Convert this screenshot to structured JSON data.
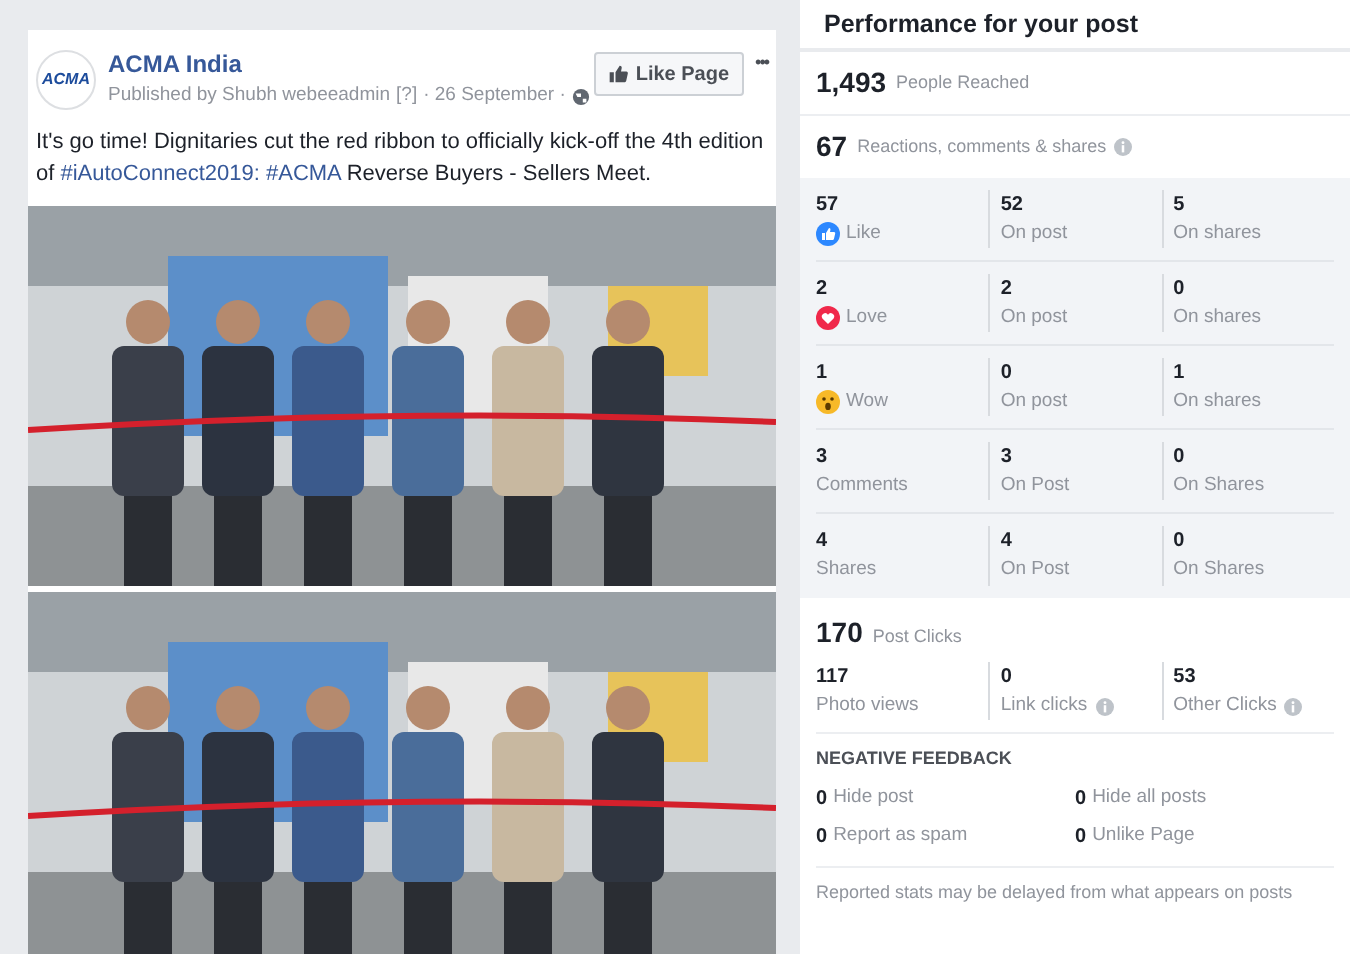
{
  "post": {
    "logo_text": "ACMA",
    "page_name": "ACMA India",
    "like_button": "Like Page",
    "more": "•••",
    "byline": "Published by Shubh webeeadmin",
    "byline_hint": "[?]",
    "date": "· 26 September ·",
    "text_parts": [
      {
        "kind": "text",
        "text": "It's go time! Dignitaries cut the red ribbon to officially kick-off the 4th edition of "
      },
      {
        "kind": "link",
        "text": "#iAutoConnect2019:"
      },
      {
        "kind": "link",
        "text": "#ACMA"
      },
      {
        "kind": "text",
        "text": " Reverse Buyers - Sellers Meet."
      }
    ]
  },
  "panel": {
    "title": "Performance for your post",
    "reached": {
      "value": "1,493",
      "label": "People Reached"
    },
    "engagement": {
      "value": "67",
      "label": "Reactions, comments & shares"
    },
    "reaction_rows": [
      {
        "kind": "like",
        "total": "57",
        "label": "Like",
        "on_post": "52",
        "on_post_label": "On post",
        "on_shares": "5",
        "on_shares_label": "On shares"
      },
      {
        "kind": "love",
        "total": "2",
        "label": "Love",
        "on_post": "2",
        "on_post_label": "On post",
        "on_shares": "0",
        "on_shares_label": "On shares"
      },
      {
        "kind": "wow",
        "total": "1",
        "label": "Wow",
        "on_post": "0",
        "on_post_label": "On post",
        "on_shares": "1",
        "on_shares_label": "On shares"
      },
      {
        "kind": "plain",
        "total": "3",
        "label": "Comments",
        "on_post": "3",
        "on_post_label": "On Post",
        "on_shares": "0",
        "on_shares_label": "On Shares"
      },
      {
        "kind": "plain",
        "total": "4",
        "label": "Shares",
        "on_post": "4",
        "on_post_label": "On Post",
        "on_shares": "0",
        "on_shares_label": "On Shares"
      }
    ],
    "clicks": {
      "value": "170",
      "label": "Post Clicks",
      "items": [
        {
          "value": "117",
          "label": "Photo views",
          "info": false
        },
        {
          "value": "0",
          "label": "Link clicks",
          "info": true
        },
        {
          "value": "53",
          "label": "Other Clicks",
          "info": true
        }
      ]
    },
    "negative": {
      "title": "NEGATIVE FEEDBACK",
      "items": [
        {
          "value": "0",
          "label": "Hide post"
        },
        {
          "value": "0",
          "label": "Hide all posts"
        },
        {
          "value": "0",
          "label": "Report as spam"
        },
        {
          "value": "0",
          "label": "Unlike Page"
        }
      ]
    },
    "footnote": "Reported stats may be delayed from what appears on posts"
  }
}
